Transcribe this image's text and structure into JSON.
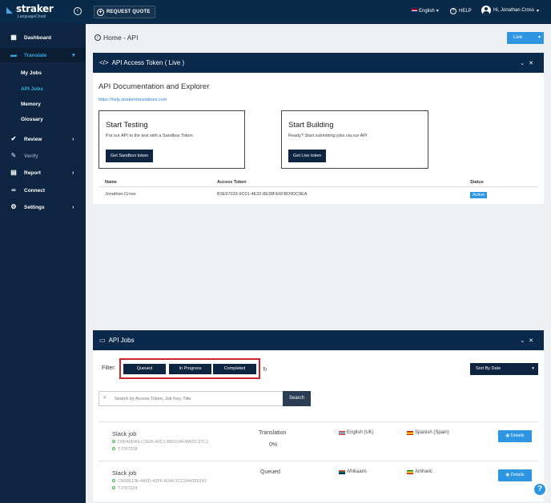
{
  "topbar": {
    "brand": "straker",
    "brand_sub": "LanguageCloud",
    "request_quote": "REQUEST QUOTE",
    "language": "English",
    "help": "HELP",
    "user": "Hi, Jonathan Cross"
  },
  "sidebar": {
    "items": [
      {
        "label": "Dashboard",
        "icon": "grid-icon"
      },
      {
        "label": "Translate",
        "icon": "translate-icon"
      },
      {
        "label": "Review",
        "icon": "check-circle-icon"
      },
      {
        "label": "Verify",
        "icon": "edit-icon"
      },
      {
        "label": "Report",
        "icon": "file-icon"
      },
      {
        "label": "Connect",
        "icon": "link-icon"
      },
      {
        "label": "Settings",
        "icon": "gear-icon"
      }
    ],
    "sub_items": [
      "My Jobs",
      "API Jobs",
      "Memory",
      "Glossary"
    ]
  },
  "breadcrumb": "Home - API",
  "env_select": "Live",
  "token_panel": {
    "title": "API Access Token ( Live )",
    "heading": "API Documentation and Explorer",
    "link": "https://help.strakertranslations.com",
    "cards": [
      {
        "title": "Start Testing",
        "desc": "Put our API to the test with a Sandbox Token",
        "button": "Get Sandbox token"
      },
      {
        "title": "Start Building",
        "desc": "Ready? Start submitting jobs via our API",
        "button": "Get Live token"
      }
    ],
    "table": {
      "headers": [
        "Name",
        "Access Token",
        "Status"
      ],
      "rows": [
        {
          "name": "Jonathan Cross",
          "token": "B3E97033-9C01-4E32-8E38FE6FBD9DC9EA",
          "status": "Active"
        }
      ]
    }
  },
  "jobs_panel": {
    "title": "API Jobs",
    "filter_label": "Filter:",
    "filters": [
      "Queued",
      "In Progress",
      "Completed"
    ],
    "sort": "Sort By Date",
    "search_placeholder": "Search by Access Token, Job Key, Title",
    "search_button": "Search",
    "jobs": [
      {
        "name": "Slack job",
        "key": "D0FA0DA5-CDEB-40C1-880104F495DC37C1",
        "tj": "TJ787328",
        "type": "Translation",
        "progress": "0%",
        "source": "English (UK)",
        "target": "Spanish (Spain)",
        "button": "Details"
      },
      {
        "name": "Slack job",
        "key": "CB68613b-4A5D-43F6-A2AF1CC3A4355242",
        "tj": "TJ787324",
        "type": "Queued",
        "progress": "",
        "source": "Afrikaans",
        "target": "Amharic",
        "button": "Details"
      }
    ]
  },
  "colors": {
    "topbar": "#0a2a4a",
    "sidebar": "#0d2540",
    "accent": "#2d95e1",
    "highlight": "#d0242b"
  }
}
